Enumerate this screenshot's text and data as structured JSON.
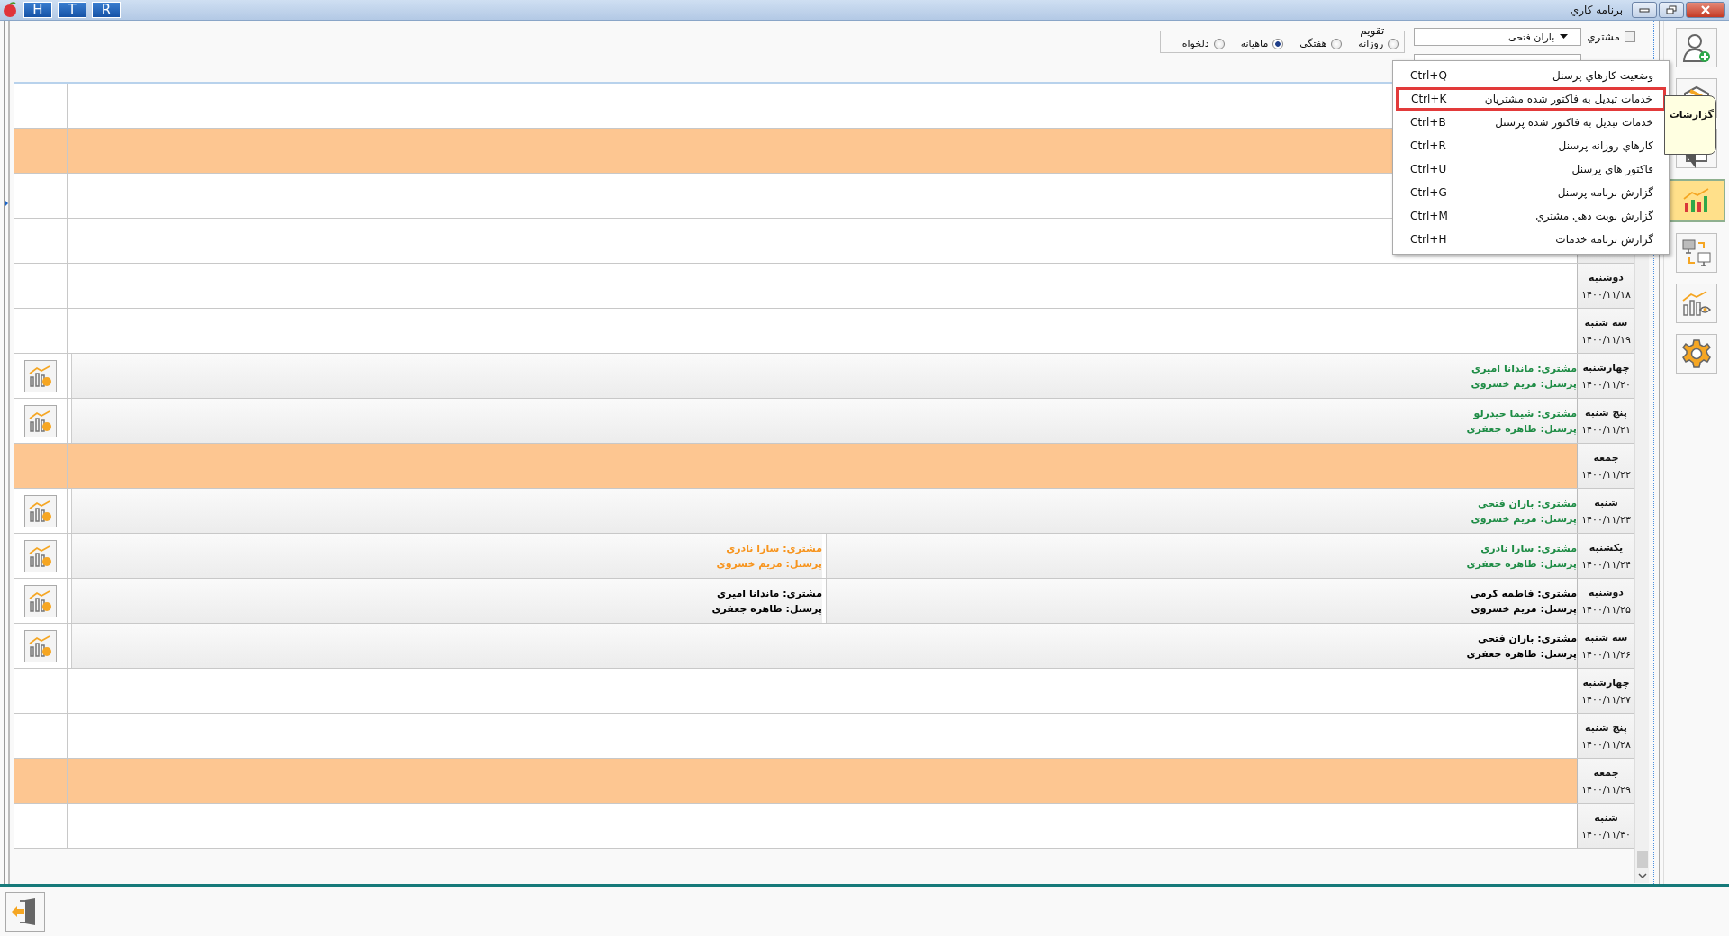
{
  "window": {
    "title": "برنامه كاري",
    "quick_buttons": [
      "R",
      "T",
      "H"
    ]
  },
  "filter": {
    "customer_label": "مشتري",
    "customer_checked": false,
    "customer_value": "باران فتحی"
  },
  "calendar": {
    "legend": "تقويم",
    "options": [
      {
        "label": "روزانه",
        "selected": false
      },
      {
        "label": "هفتگی",
        "selected": false
      },
      {
        "label": "ماهيانه",
        "selected": true
      },
      {
        "label": "دلخواه",
        "selected": false
      }
    ]
  },
  "sidebar": {
    "tools": [
      {
        "kind": "user-add",
        "selected": false
      },
      {
        "kind": "box",
        "selected": false
      },
      {
        "kind": "document",
        "selected": false
      },
      {
        "kind": "reports",
        "selected": true
      },
      {
        "kind": "transfer",
        "selected": false
      },
      {
        "kind": "analytics",
        "selected": false
      },
      {
        "kind": "settings",
        "selected": false
      }
    ]
  },
  "tooltip": {
    "text": "گزارشات"
  },
  "menu": [
    {
      "label": "وضعيت كارهاي پرسنل",
      "shortcut": "Ctrl+Q",
      "selected": false
    },
    {
      "label": "خدمات تبدیل به فاکتور شده مشتریان",
      "shortcut": "Ctrl+K",
      "selected": true
    },
    {
      "label": "خدمات تبدیل به فاکتور شده پرسنل",
      "shortcut": "Ctrl+B",
      "selected": false
    },
    {
      "label": "كارهاي روزانه پرسنل",
      "shortcut": "Ctrl+R",
      "selected": false
    },
    {
      "label": "فاكتور هاي پرسنل",
      "shortcut": "Ctrl+U",
      "selected": false
    },
    {
      "label": "گزارش برنامه پرسنل",
      "shortcut": "Ctrl+G",
      "selected": false
    },
    {
      "label": "گزارش نوبت دهي مشتري",
      "shortcut": "Ctrl+M",
      "selected": false
    },
    {
      "label": "گزارش برنامه خدمات",
      "shortcut": "Ctrl+H",
      "selected": false
    }
  ],
  "days": [
    {
      "holiday": false
    },
    {
      "holiday": true
    },
    {
      "holiday": false
    },
    {
      "holiday": false
    },
    {
      "day": "دوشنبه",
      "date": "۱۴۰۰/۱۱/۱۸",
      "holiday": false
    },
    {
      "day": "سه شنبه",
      "date": "۱۴۰۰/۱۱/۱۹",
      "holiday": false
    },
    {
      "day": "چهارشنبه",
      "date": "۱۴۰۰/۱۱/۲۰",
      "holiday": false,
      "entries": [
        {
          "customer": "مشتری: ماندانا امیری",
          "staff": "پرسنل: مریم خسروی",
          "color": "#1e8c45"
        }
      ]
    },
    {
      "day": "پنج شنبه",
      "date": "۱۴۰۰/۱۱/۲۱",
      "holiday": false,
      "entries": [
        {
          "customer": "مشتری: شیما حیدرلو",
          "staff": "پرسنل: طاهره جعفری",
          "color": "#1e8c45"
        }
      ]
    },
    {
      "day": "جمعه",
      "date": "۱۴۰۰/۱۱/۲۲",
      "holiday": true
    },
    {
      "day": "شنبه",
      "date": "۱۴۰۰/۱۱/۲۳",
      "holiday": false,
      "entries": [
        {
          "customer": "مشتری: باران فتحی",
          "staff": "پرسنل: مریم خسروی",
          "color": "#1e8c45"
        }
      ]
    },
    {
      "day": "يکشنبه",
      "date": "۱۴۰۰/۱۱/۲۴",
      "holiday": false,
      "entries": [
        {
          "customer": "مشتری: سارا نادری",
          "staff": "پرسنل: طاهره جعفری",
          "color": "#1e8c45"
        },
        {
          "customer": "مشتری: سارا نادری",
          "staff": "پرسنل: مریم خسروی",
          "color": "#f7941d"
        }
      ]
    },
    {
      "day": "دوشنبه",
      "date": "۱۴۰۰/۱۱/۲۵",
      "holiday": false,
      "entries": [
        {
          "customer": "مشتری: فاطمه کرمی",
          "staff": "پرسنل: مریم خسروی",
          "color": "#000000"
        },
        {
          "customer": "مشتری: ماندانا امیری",
          "staff": "پرسنل: طاهره جعفری",
          "color": "#000000"
        }
      ]
    },
    {
      "day": "سه شنبه",
      "date": "۱۴۰۰/۱۱/۲۶",
      "holiday": false,
      "entries": [
        {
          "customer": "مشتری: باران فتحی",
          "staff": "پرسنل: طاهره جعفری",
          "color": "#000000"
        }
      ]
    },
    {
      "day": "چهارشنبه",
      "date": "۱۴۰۰/۱۱/۲۷",
      "holiday": false
    },
    {
      "day": "پنج شنبه",
      "date": "۱۴۰۰/۱۱/۲۸",
      "holiday": false
    },
    {
      "day": "جمعه",
      "date": "۱۴۰۰/۱۱/۲۹",
      "holiday": true
    },
    {
      "day": "شنبه",
      "date": "۱۴۰۰/۱۱/۳۰",
      "holiday": false
    }
  ]
}
